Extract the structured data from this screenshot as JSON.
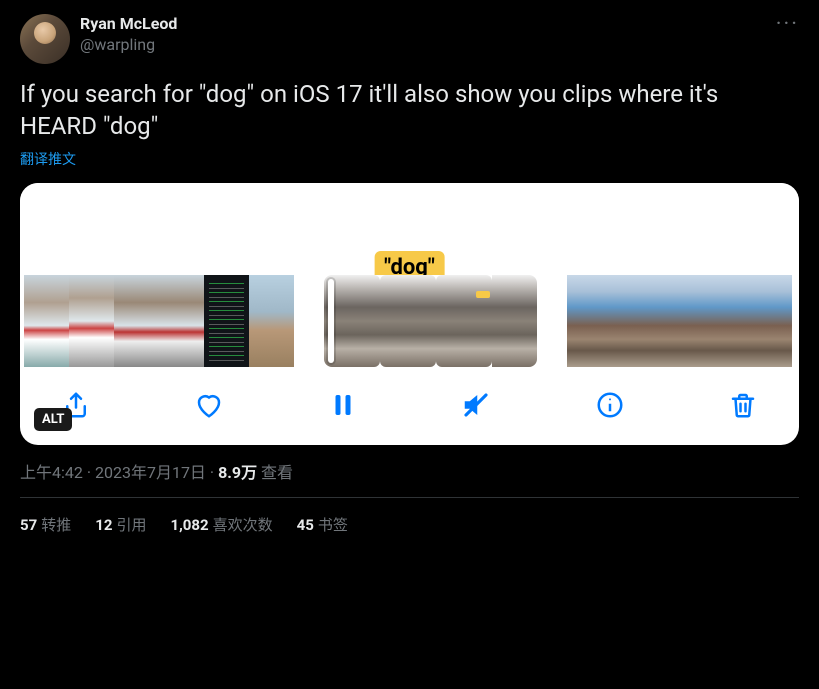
{
  "author": {
    "display_name": "Ryan McLeod",
    "handle": "@warpling"
  },
  "body": "If you search for \"dog\" on iOS 17 it'll also show you clips where it's HEARD \"dog\"",
  "translate": "翻译推文",
  "media": {
    "highlight_label": "\"dog\"",
    "alt_badge": "ALT"
  },
  "meta": {
    "time": "上午4:42",
    "sep": " · ",
    "date": "2023年7月17日",
    "views_num": "8.9万",
    "views_label": " 查看"
  },
  "stats": {
    "retweets_n": "57",
    "retweets_l": "转推",
    "quotes_n": "12",
    "quotes_l": "引用",
    "likes_n": "1,082",
    "likes_l": "喜欢次数",
    "bookmarks_n": "45",
    "bookmarks_l": "书签"
  }
}
